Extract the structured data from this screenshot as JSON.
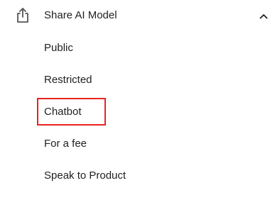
{
  "menu": {
    "header": {
      "label": "Share AI Model",
      "icon": "share-icon",
      "toggle_icon": "chevron-up-icon"
    },
    "items": [
      {
        "label": "Public"
      },
      {
        "label": "Restricted"
      },
      {
        "label": "Chatbot",
        "highlighted": true
      },
      {
        "label": "For a fee"
      },
      {
        "label": "Speak to Product"
      }
    ]
  },
  "colors": {
    "text": "#222222",
    "icon": "#555555",
    "highlight": "#e8231f",
    "background": "#ffffff"
  }
}
